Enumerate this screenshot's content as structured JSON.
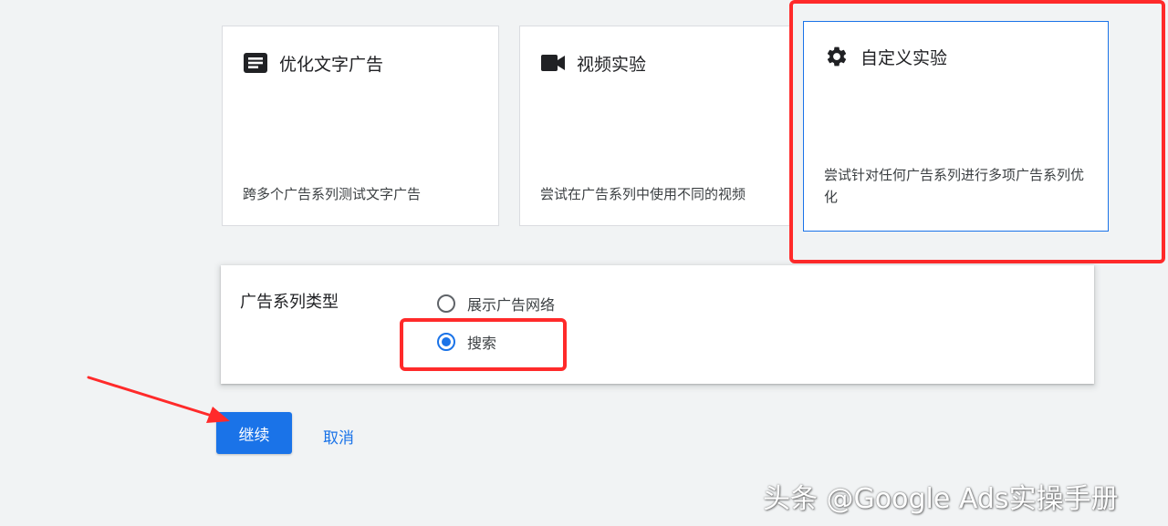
{
  "experiment_cards": [
    {
      "title": "优化文字广告",
      "description": "跨多个广告系列测试文字广告",
      "icon": "ad-text-icon"
    },
    {
      "title": "视频实验",
      "description": "尝试在广告系列中使用不同的视频",
      "icon": "videocam-icon"
    },
    {
      "title": "自定义实验",
      "description": "尝试针对任何广告系列进行多项广告系列优化",
      "icon": "gear-icon"
    }
  ],
  "campaign_type": {
    "label": "广告系列类型",
    "options": [
      {
        "label": "展示广告网络",
        "selected": false
      },
      {
        "label": "搜索",
        "selected": true
      }
    ]
  },
  "actions": {
    "continue_label": "继续",
    "cancel_label": "取消"
  },
  "watermark": "头条 @Google Ads实操手册",
  "colors": {
    "accent": "#1a73e8",
    "annotation": "#ff2a2a",
    "background": "#f1f3f4"
  }
}
